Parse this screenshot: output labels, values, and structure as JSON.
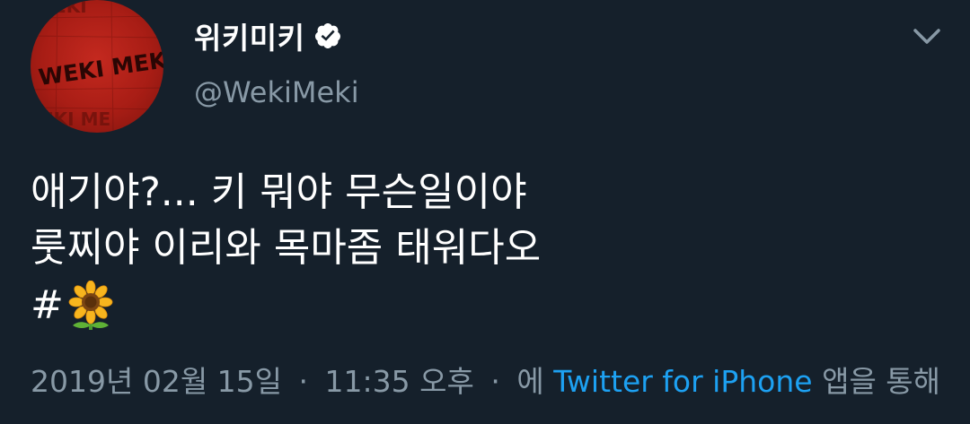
{
  "tweet": {
    "author": {
      "display_name": "위키미키",
      "handle": "@WekiMeki",
      "verified": true,
      "avatar_text": "WEKI MEKI"
    },
    "text_lines": [
      "애기야?... 키 뭐야 무슨일이야",
      "룻찌야 이리와 목마좀 태워다오"
    ],
    "hashtag": "#",
    "emoji": "sunflower",
    "meta": {
      "date": "2019년 02월 15일",
      "separator": "·",
      "time": "11:35 오후",
      "via_prefix": "에",
      "source": "Twitter for iPhone",
      "via_suffix": "앱을 통해"
    }
  },
  "icons": {
    "verified": "verified-badge-icon",
    "menu": "chevron-down-icon"
  },
  "colors": {
    "background": "#15202b",
    "text": "#ffffff",
    "secondary": "#8899a6",
    "link": "#1da1f2",
    "avatar": "#b3221a"
  }
}
